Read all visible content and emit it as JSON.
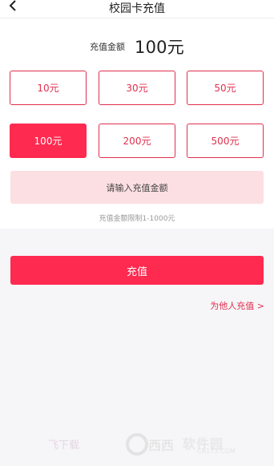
{
  "header": {
    "title": "校园卡充值"
  },
  "amount": {
    "label": "充值金额",
    "value": "100元"
  },
  "options": [
    {
      "label": "10元",
      "selected": false
    },
    {
      "label": "30元",
      "selected": false
    },
    {
      "label": "50元",
      "selected": false
    },
    {
      "label": "100元",
      "selected": true
    },
    {
      "label": "200元",
      "selected": false
    },
    {
      "label": "500元",
      "selected": false
    }
  ],
  "input": {
    "placeholder": "请输入充值金额"
  },
  "limit_text": "充值金额限制1-1000元",
  "recharge_button": "充值",
  "for_others_link": "为他人充值 >",
  "watermark": {
    "left_text": "飞下载",
    "brand": "软件园",
    "site": "CR173.COM"
  },
  "colors": {
    "accent": "#ff2a4f",
    "accent_border": "#e0304e",
    "input_bg": "#fcdfe2"
  }
}
